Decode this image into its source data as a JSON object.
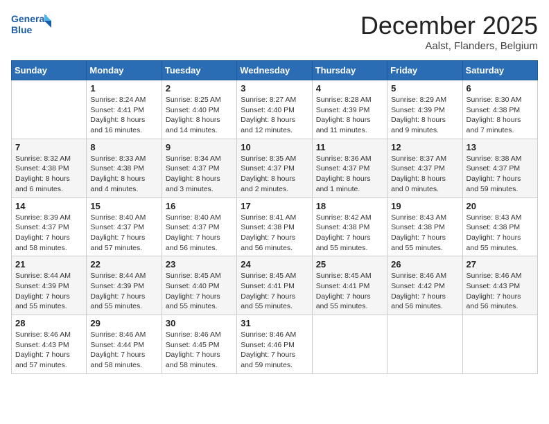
{
  "logo": {
    "line1": "General",
    "line2": "Blue"
  },
  "title": "December 2025",
  "location": "Aalst, Flanders, Belgium",
  "days_of_week": [
    "Sunday",
    "Monday",
    "Tuesday",
    "Wednesday",
    "Thursday",
    "Friday",
    "Saturday"
  ],
  "weeks": [
    [
      {
        "day": "",
        "info": ""
      },
      {
        "day": "1",
        "info": "Sunrise: 8:24 AM\nSunset: 4:41 PM\nDaylight: 8 hours\nand 16 minutes."
      },
      {
        "day": "2",
        "info": "Sunrise: 8:25 AM\nSunset: 4:40 PM\nDaylight: 8 hours\nand 14 minutes."
      },
      {
        "day": "3",
        "info": "Sunrise: 8:27 AM\nSunset: 4:40 PM\nDaylight: 8 hours\nand 12 minutes."
      },
      {
        "day": "4",
        "info": "Sunrise: 8:28 AM\nSunset: 4:39 PM\nDaylight: 8 hours\nand 11 minutes."
      },
      {
        "day": "5",
        "info": "Sunrise: 8:29 AM\nSunset: 4:39 PM\nDaylight: 8 hours\nand 9 minutes."
      },
      {
        "day": "6",
        "info": "Sunrise: 8:30 AM\nSunset: 4:38 PM\nDaylight: 8 hours\nand 7 minutes."
      }
    ],
    [
      {
        "day": "7",
        "info": "Sunrise: 8:32 AM\nSunset: 4:38 PM\nDaylight: 8 hours\nand 6 minutes."
      },
      {
        "day": "8",
        "info": "Sunrise: 8:33 AM\nSunset: 4:38 PM\nDaylight: 8 hours\nand 4 minutes."
      },
      {
        "day": "9",
        "info": "Sunrise: 8:34 AM\nSunset: 4:37 PM\nDaylight: 8 hours\nand 3 minutes."
      },
      {
        "day": "10",
        "info": "Sunrise: 8:35 AM\nSunset: 4:37 PM\nDaylight: 8 hours\nand 2 minutes."
      },
      {
        "day": "11",
        "info": "Sunrise: 8:36 AM\nSunset: 4:37 PM\nDaylight: 8 hours\nand 1 minute."
      },
      {
        "day": "12",
        "info": "Sunrise: 8:37 AM\nSunset: 4:37 PM\nDaylight: 8 hours\nand 0 minutes."
      },
      {
        "day": "13",
        "info": "Sunrise: 8:38 AM\nSunset: 4:37 PM\nDaylight: 7 hours\nand 59 minutes."
      }
    ],
    [
      {
        "day": "14",
        "info": "Sunrise: 8:39 AM\nSunset: 4:37 PM\nDaylight: 7 hours\nand 58 minutes."
      },
      {
        "day": "15",
        "info": "Sunrise: 8:40 AM\nSunset: 4:37 PM\nDaylight: 7 hours\nand 57 minutes."
      },
      {
        "day": "16",
        "info": "Sunrise: 8:40 AM\nSunset: 4:37 PM\nDaylight: 7 hours\nand 56 minutes."
      },
      {
        "day": "17",
        "info": "Sunrise: 8:41 AM\nSunset: 4:38 PM\nDaylight: 7 hours\nand 56 minutes."
      },
      {
        "day": "18",
        "info": "Sunrise: 8:42 AM\nSunset: 4:38 PM\nDaylight: 7 hours\nand 55 minutes."
      },
      {
        "day": "19",
        "info": "Sunrise: 8:43 AM\nSunset: 4:38 PM\nDaylight: 7 hours\nand 55 minutes."
      },
      {
        "day": "20",
        "info": "Sunrise: 8:43 AM\nSunset: 4:38 PM\nDaylight: 7 hours\nand 55 minutes."
      }
    ],
    [
      {
        "day": "21",
        "info": "Sunrise: 8:44 AM\nSunset: 4:39 PM\nDaylight: 7 hours\nand 55 minutes."
      },
      {
        "day": "22",
        "info": "Sunrise: 8:44 AM\nSunset: 4:39 PM\nDaylight: 7 hours\nand 55 minutes."
      },
      {
        "day": "23",
        "info": "Sunrise: 8:45 AM\nSunset: 4:40 PM\nDaylight: 7 hours\nand 55 minutes."
      },
      {
        "day": "24",
        "info": "Sunrise: 8:45 AM\nSunset: 4:41 PM\nDaylight: 7 hours\nand 55 minutes."
      },
      {
        "day": "25",
        "info": "Sunrise: 8:45 AM\nSunset: 4:41 PM\nDaylight: 7 hours\nand 55 minutes."
      },
      {
        "day": "26",
        "info": "Sunrise: 8:46 AM\nSunset: 4:42 PM\nDaylight: 7 hours\nand 56 minutes."
      },
      {
        "day": "27",
        "info": "Sunrise: 8:46 AM\nSunset: 4:43 PM\nDaylight: 7 hours\nand 56 minutes."
      }
    ],
    [
      {
        "day": "28",
        "info": "Sunrise: 8:46 AM\nSunset: 4:43 PM\nDaylight: 7 hours\nand 57 minutes."
      },
      {
        "day": "29",
        "info": "Sunrise: 8:46 AM\nSunset: 4:44 PM\nDaylight: 7 hours\nand 58 minutes."
      },
      {
        "day": "30",
        "info": "Sunrise: 8:46 AM\nSunset: 4:45 PM\nDaylight: 7 hours\nand 58 minutes."
      },
      {
        "day": "31",
        "info": "Sunrise: 8:46 AM\nSunset: 4:46 PM\nDaylight: 7 hours\nand 59 minutes."
      },
      {
        "day": "",
        "info": ""
      },
      {
        "day": "",
        "info": ""
      },
      {
        "day": "",
        "info": ""
      }
    ]
  ]
}
